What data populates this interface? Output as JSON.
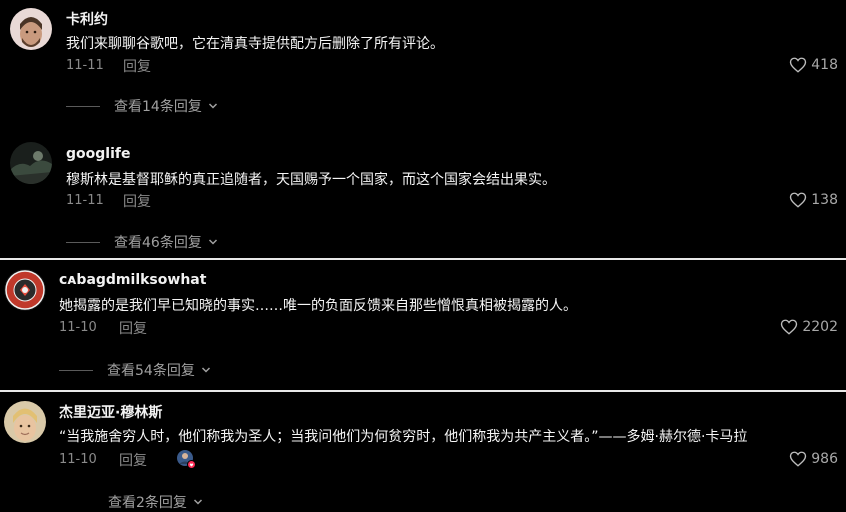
{
  "colors": {
    "background": "#000000",
    "divider": "#e8e8e8",
    "muted_text": "#8a8a8a",
    "heart_badge": "#fe2c55"
  },
  "comments": [
    {
      "username": "卡利约",
      "text": "我们来聊聊谷歌吧，它在清真寺提供配方后删除了所有评论。",
      "date": "11-11",
      "reply_label": "回复",
      "likes": "418",
      "view_replies": "查看14条回复",
      "avatar": "bearded-man-avatar"
    },
    {
      "username": "googlife",
      "text": "穆斯林是基督耶稣的真正追随者，天国赐予一个国家，而这个国家会结出果实。",
      "date": "11-11",
      "reply_label": "回复",
      "likes": "138",
      "view_replies": "查看46条回复",
      "avatar": "dark-landscape-avatar"
    },
    {
      "username": "ᴄᴀbagdmilksowhat",
      "text": "她揭露的是我们早已知晓的事实……唯一的负面反馈来自那些憎恨真相被揭露的人。",
      "date": "11-10",
      "reply_label": "回复",
      "likes": "2202",
      "view_replies": "查看54条回复",
      "avatar": "stay-lit-badge-avatar"
    },
    {
      "username": "杰里迈亚·穆林斯",
      "text": "“当我施舍穷人时，他们称我为圣人；当我问他们为何贫穷时，他们称我为共产主义者。”——多姆·赫尔德·卡马拉",
      "date": "11-10",
      "reply_label": "回复",
      "likes": "986",
      "view_replies": "查看2条回复",
      "avatar": "blond-man-avatar",
      "creator_liked_icon": "creator-liked-avatar-icon"
    }
  ]
}
